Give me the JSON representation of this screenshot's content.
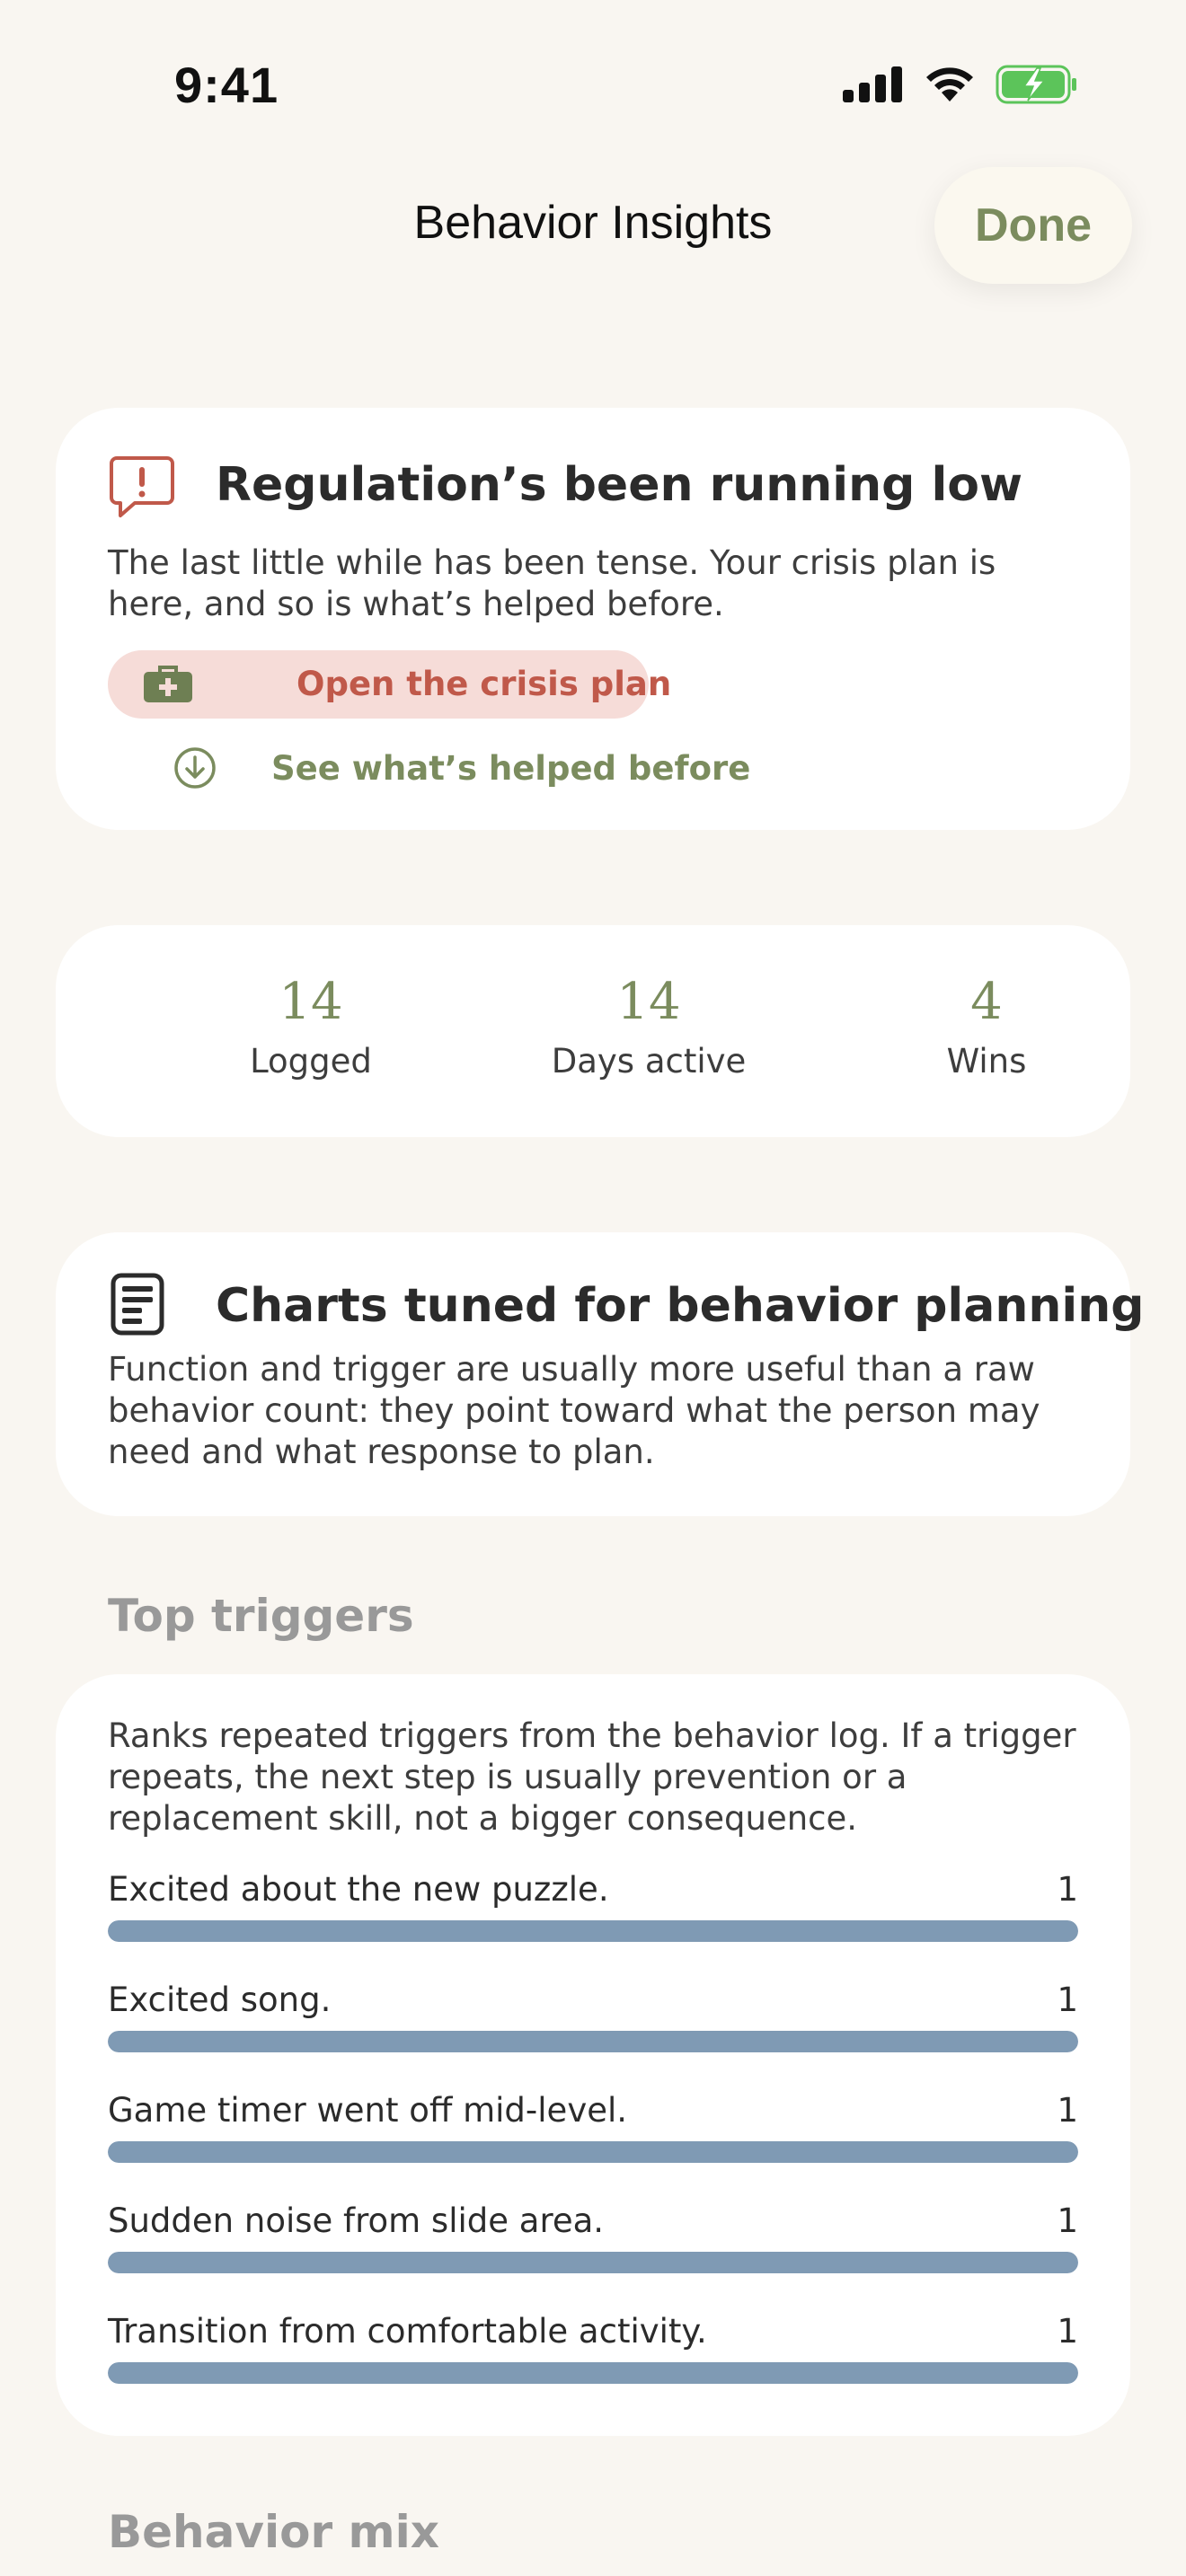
{
  "status_bar": {
    "time": "9:41",
    "icons": [
      "signal-icon",
      "wifi-icon",
      "battery-charging-icon"
    ],
    "battery_color": "#5cc45a"
  },
  "nav": {
    "title": "Behavior Insights",
    "done_label": "Done"
  },
  "crisis": {
    "icon": "alert-bubble-icon",
    "title": "Regulation’s been running low",
    "body": "The last little while has been tense. Your crisis plan is here, and so is what’s helped before.",
    "plan_button_label": "Open the crisis plan",
    "plan_button_icon": "first-aid-kit-icon",
    "helped_label": "See what’s helped before",
    "helped_icon": "arrow-down-circle-icon",
    "accent_color": "#c0594a"
  },
  "stats": [
    {
      "value": "14",
      "label": "Logged"
    },
    {
      "value": "14",
      "label": "Days active"
    },
    {
      "value": "4",
      "label": "Wins"
    }
  ],
  "tuned": {
    "icon": "document-icon",
    "title": "Charts tuned for behavior planning",
    "body": "Function and trigger are usually more useful than a raw behavior count: they point toward what the person may need and what response to plan."
  },
  "top_triggers": {
    "header": "Top triggers",
    "description": "Ranks repeated triggers from the behavior log. If a trigger repeats, the next step is usually prevention or a replacement skill, not a bigger consequence.",
    "bar_color": "#7f9ab4",
    "items": [
      {
        "label": "Excited about the new puzzle.",
        "count": "1",
        "fraction": 1.0
      },
      {
        "label": "Excited song.",
        "count": "1",
        "fraction": 1.0
      },
      {
        "label": "Game timer went off mid-level.",
        "count": "1",
        "fraction": 1.0
      },
      {
        "label": "Sudden noise from slide area.",
        "count": "1",
        "fraction": 1.0
      },
      {
        "label": "Transition from comfortable activity.",
        "count": "1",
        "fraction": 1.0
      }
    ]
  },
  "behavior_mix": {
    "header": "Behavior mix"
  }
}
